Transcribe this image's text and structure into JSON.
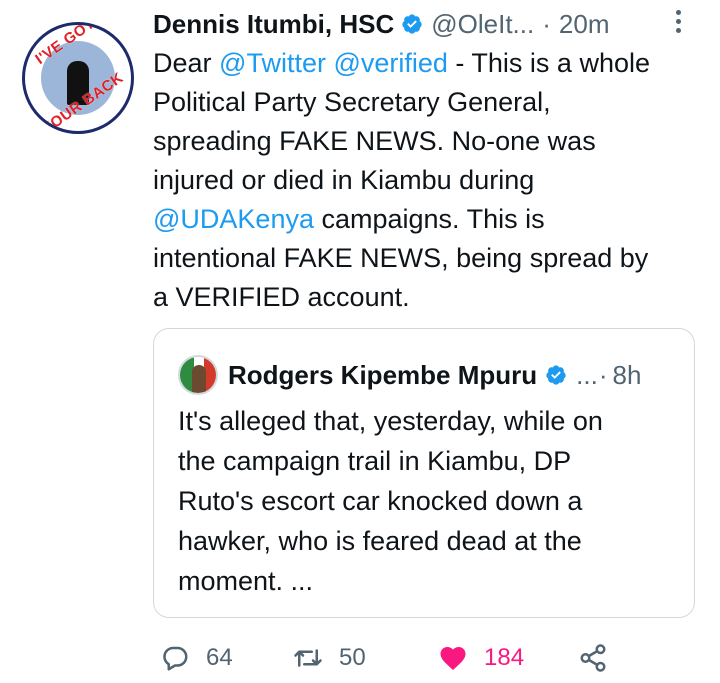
{
  "tweet": {
    "author_name": "Dennis Itumbi, HSC",
    "author_handle": "@OleIt...",
    "separator": "·",
    "time": "20m",
    "avatar_text_top": "I'VE GOT",
    "avatar_text_bottom": "YOUR BACK",
    "body_lines": [
      {
        "pre": "Dear ",
        "m1": "@Twitter",
        "mid": " ",
        "m2": "@verified",
        "post": " - This is a whole"
      },
      "Political Party Secretary General,",
      "spreading FAKE NEWS. No-one was",
      "injured or died in Kiambu during",
      {
        "m1": "@UDAKenya",
        "post": " campaigns. This is"
      },
      "intentional FAKE NEWS, being spread by",
      "a VERIFIED account."
    ]
  },
  "quoted": {
    "author_name": "Rodgers Kipembe Mpuru",
    "author_handle": "...",
    "separator": "·",
    "time": "8h",
    "body_lines": [
      "It's alleged that, yesterday, while on",
      "the campaign trail in Kiambu, DP",
      "Ruto's escort car knocked down a",
      "hawker, who is feared dead at the",
      "moment. ..."
    ]
  },
  "actions": {
    "reply_count": "64",
    "retweet_count": "50",
    "like_count": "184"
  },
  "colors": {
    "accent": "#1d9bf0",
    "like": "#f91880",
    "muted": "#536471",
    "border": "#cfd9de"
  },
  "icons": [
    "verified-badge-icon",
    "more-icon",
    "reply-icon",
    "retweet-icon",
    "heart-icon",
    "share-icon"
  ]
}
